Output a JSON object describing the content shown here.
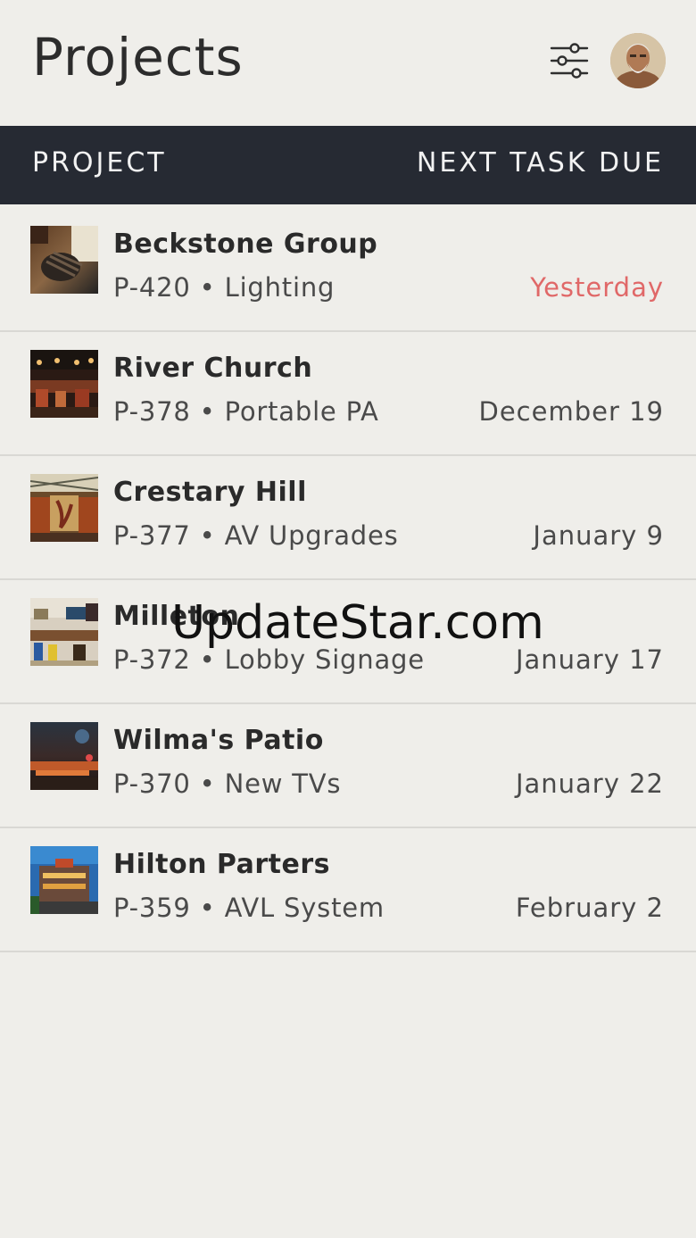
{
  "header": {
    "title": "Projects",
    "filter_icon": "sliders-icon",
    "avatar_icon": "user-avatar"
  },
  "columns": {
    "project": "PROJECT",
    "next_task_due": "NEXT TASK DUE"
  },
  "projects": [
    {
      "name": "Beckstone Group",
      "code": "P-420",
      "category": "Lighting",
      "subtitle": "P-420 • Lighting",
      "due": "Yesterday",
      "overdue": true
    },
    {
      "name": "River Church",
      "code": "P-378",
      "category": "Portable PA",
      "subtitle": "P-378 • Portable PA",
      "due": "December 19",
      "overdue": false
    },
    {
      "name": "Crestary Hill",
      "code": "P-377",
      "category": "AV Upgrades",
      "subtitle": "P-377 • AV Upgrades",
      "due": "January 9",
      "overdue": false
    },
    {
      "name": "Milleton",
      "code": "P-372",
      "category": "Lobby Signage",
      "subtitle": "P-372 • Lobby Signage",
      "due": "January 17",
      "overdue": false
    },
    {
      "name": "Wilma's Patio",
      "code": "P-370",
      "category": "New TVs",
      "subtitle": "P-370 • New TVs",
      "due": "January 22",
      "overdue": false
    },
    {
      "name": "Hilton Parters",
      "code": "P-359",
      "category": "AVL System",
      "subtitle": "P-359 • AVL System",
      "due": "February 2",
      "overdue": false
    }
  ],
  "colors": {
    "background": "#efeeea",
    "header_bar": "#262a33",
    "overdue": "#e06868",
    "divider": "#d9d8d4"
  },
  "watermark": "UpdateStar.com"
}
